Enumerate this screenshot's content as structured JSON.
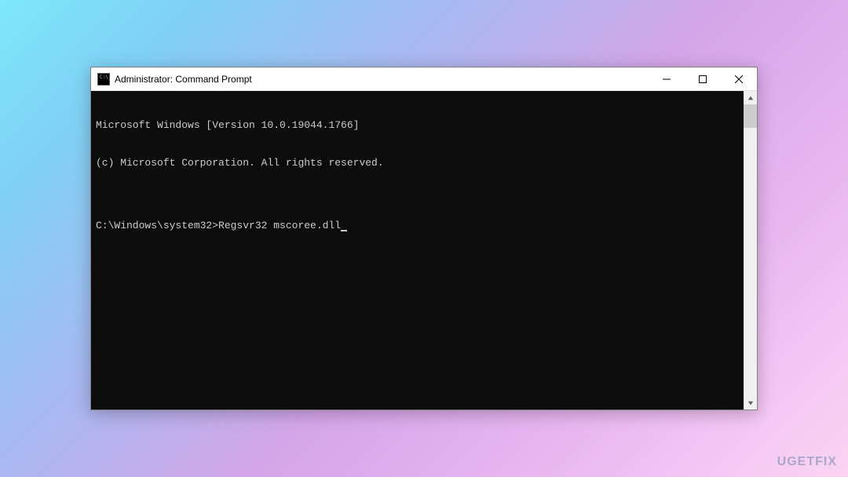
{
  "window": {
    "title": "Administrator: Command Prompt"
  },
  "terminal": {
    "line1": "Microsoft Windows [Version 10.0.19044.1766]",
    "line2": "(c) Microsoft Corporation. All rights reserved.",
    "blank": "",
    "prompt": "C:\\Windows\\system32>",
    "command": "Regsvr32 mscoree.dll"
  },
  "watermark": "UGETFIX"
}
